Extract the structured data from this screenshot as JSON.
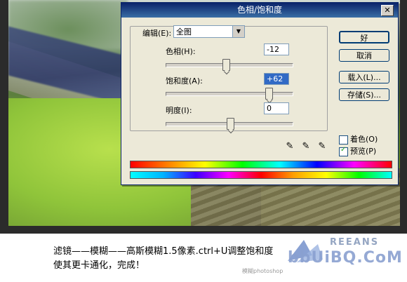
{
  "dialog": {
    "title": "色相/饱和度",
    "close": "✕",
    "edit_label": "编辑(E):",
    "edit_value": "全图",
    "hue_label": "色相(H):",
    "hue_value": "-12",
    "hue_level": -12,
    "sat_label": "饱和度(A):",
    "sat_value": "+62",
    "sat_level": 62,
    "light_label": "明度(I):",
    "light_value": "0",
    "light_level": 0,
    "buttons": {
      "ok": "好",
      "cancel": "取消",
      "load": "载入(L)...",
      "save": "存储(S)..."
    },
    "colorize_label": "着色(O)",
    "colorize_checked": false,
    "preview_label": "预览(P)",
    "preview_checked": true
  },
  "caption": {
    "line1": "滤镜——模糊——高斯模糊1.5像素.ctrl+U调整饱和度",
    "line2": "使其更卡通化，完成！"
  },
  "watermark": {
    "big": "bbUiBQ.CoM",
    "top": "REEANS",
    "small": "模糊photoshop"
  }
}
